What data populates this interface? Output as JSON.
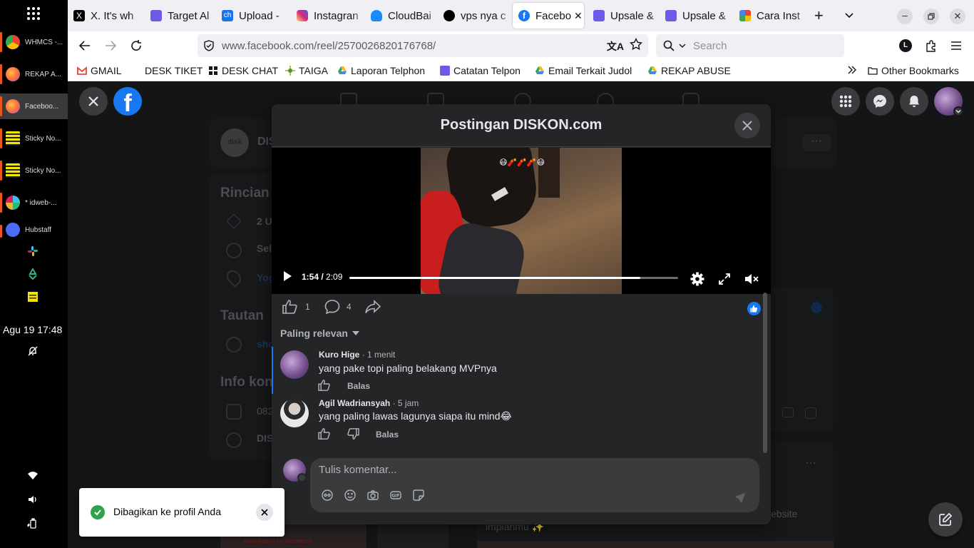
{
  "dock": {
    "items": [
      {
        "label": "WHMCS -...",
        "icon": "chrome-icon"
      },
      {
        "label": "REKAP A...",
        "icon": "firefox-icon"
      },
      {
        "label": "Faceboo...",
        "icon": "firefox-icon"
      },
      {
        "label": "Sticky No...",
        "icon": "sticky-notes-icon"
      },
      {
        "label": "Sticky No...",
        "icon": "sticky-notes-icon"
      },
      {
        "label": "* idweb-...",
        "icon": "slack-icon"
      },
      {
        "label": "Hubstaff",
        "icon": "hubstaff-icon"
      }
    ],
    "clock": "Agu 19  17:48"
  },
  "tabs": [
    {
      "label": "X. It's wh",
      "icon": "x-icon",
      "color": "#000000"
    },
    {
      "label": "Target Al",
      "icon": "upsale-icon",
      "color": "#6b5be6"
    },
    {
      "label": "Upload - ",
      "icon": "ch-icon",
      "color": "#1a73e8"
    },
    {
      "label": "Instagran",
      "icon": "instagram-icon",
      "color": "#e1306c"
    },
    {
      "label": "CloudBai",
      "icon": "cloud-icon",
      "color": "#1a8cff"
    },
    {
      "label": "vps nya c",
      "icon": "threads-icon",
      "color": "#000000"
    },
    {
      "label": "Facebo",
      "icon": "facebook-icon",
      "color": "#1877f2"
    },
    {
      "label": "Upsale &",
      "icon": "upsale-icon",
      "color": "#6b5be6"
    },
    {
      "label": "Upsale &",
      "icon": "upsale-icon",
      "color": "#6b5be6"
    },
    {
      "label": "Cara Inst",
      "icon": "google-icon",
      "color": "#ea4335"
    }
  ],
  "nav": {
    "url_domain": "www.facebook.com",
    "url_path": "/reel/2570026820176768/",
    "search_placeholder": "Search",
    "profile_letter": "L"
  },
  "bookmarks": [
    {
      "label": "GMAIL",
      "icon": "gmail-icon"
    },
    {
      "label": "DESK TIKET",
      "icon": "none"
    },
    {
      "label": "DESK CHAT",
      "icon": "desk-chat-icon"
    },
    {
      "label": "TAIGA",
      "icon": "taiga-icon"
    },
    {
      "label": "Laporan Telphon",
      "icon": "gdrive-icon"
    },
    {
      "label": "Catatan Telpon",
      "icon": "upsale-icon"
    },
    {
      "label": "Email Terkait Judol",
      "icon": "gdrive-icon"
    },
    {
      "label": "REKAP ABUSE",
      "icon": "gdrive-icon"
    }
  ],
  "other_bookmarks": "Other Bookmarks",
  "background": {
    "page_initial": "DIS",
    "section_rincian": "Rincian",
    "rincian_rows": [
      "2 U",
      "Sel",
      "Yog"
    ],
    "section_tautan": "Tautan",
    "tautan_row": "sho",
    "section_info": "Info kon",
    "info_rows": [
      "082",
      "DIS"
    ],
    "right_text_1": "website",
    "right_text_2": "impianmu ✨",
    "banner_text": "KEMERDEKAAN INDONESIA"
  },
  "modal": {
    "title": "Postingan DISKON.com",
    "video": {
      "current": "1:54",
      "total": "2:09",
      "progress": 0.884,
      "overlay_emoji": "😷🧨🧨🧨😷"
    },
    "likes": "1",
    "comments_count": "4",
    "sort_label": "Paling relevan",
    "comments": [
      {
        "author": "Kuro Hige",
        "time": "· 1 menit",
        "text": "yang pake topi paling belakang MVPnya",
        "reply": "Balas",
        "avatar_color": "#8a6fa8"
      },
      {
        "author": "Agil Wadriansyah",
        "time": "· 5 jam",
        "text": "yang paling lawas lagunya siapa itu mind😂",
        "reply": "Balas",
        "avatar_color": "#5a5a5a"
      }
    ],
    "compose_placeholder": "Tulis komentar..."
  },
  "toast": {
    "message": "Dibagikan ke profil Anda"
  },
  "colors": {
    "fb_blue": "#1877f2",
    "accent_orange": "#e95420",
    "toast_green": "#31a24c"
  }
}
